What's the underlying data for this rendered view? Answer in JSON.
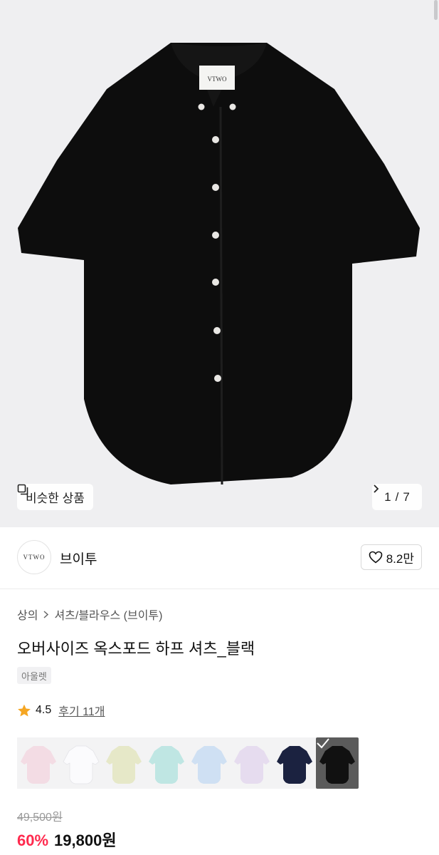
{
  "hero": {
    "similar_label": "비슷한 상품",
    "page_current": "1",
    "page_sep": "/",
    "page_total": "7",
    "shirt_color": "#0d0d0d",
    "shirt_label_text": "VTWO"
  },
  "brand": {
    "logo_text": "VTWO",
    "name": "브이투",
    "likes": "8.2만"
  },
  "breadcrumb": {
    "category": "상의",
    "subcategory": "셔츠/블라우스 (브이투)"
  },
  "product": {
    "title": "오버사이즈 옥스포드 하프 셔츠_블랙",
    "tag": "아울렛",
    "rating": "4.5",
    "review_label": "후기 11개",
    "original_price": "49,500원",
    "discount": "60%",
    "price": "19,800원"
  },
  "swatches": [
    {
      "color": "#f3dce4",
      "selected": false
    },
    {
      "color": "#fbfbfd",
      "selected": false
    },
    {
      "color": "#e6e8c8",
      "selected": false
    },
    {
      "color": "#bfe6e3",
      "selected": false
    },
    {
      "color": "#cfe0f3",
      "selected": false
    },
    {
      "color": "#e6dcef",
      "selected": false
    },
    {
      "color": "#1b2240",
      "selected": false
    },
    {
      "color": "#111111",
      "selected": true
    }
  ],
  "icons": {
    "similar": "copy-icon",
    "next": "chevron-right-icon",
    "heart": "heart-icon",
    "breadcrumb_sep": "chevron-right-icon",
    "star": "star-icon",
    "check": "check-icon"
  },
  "colors": {
    "discount": "#ff2a4e",
    "star": "#f5a623"
  }
}
